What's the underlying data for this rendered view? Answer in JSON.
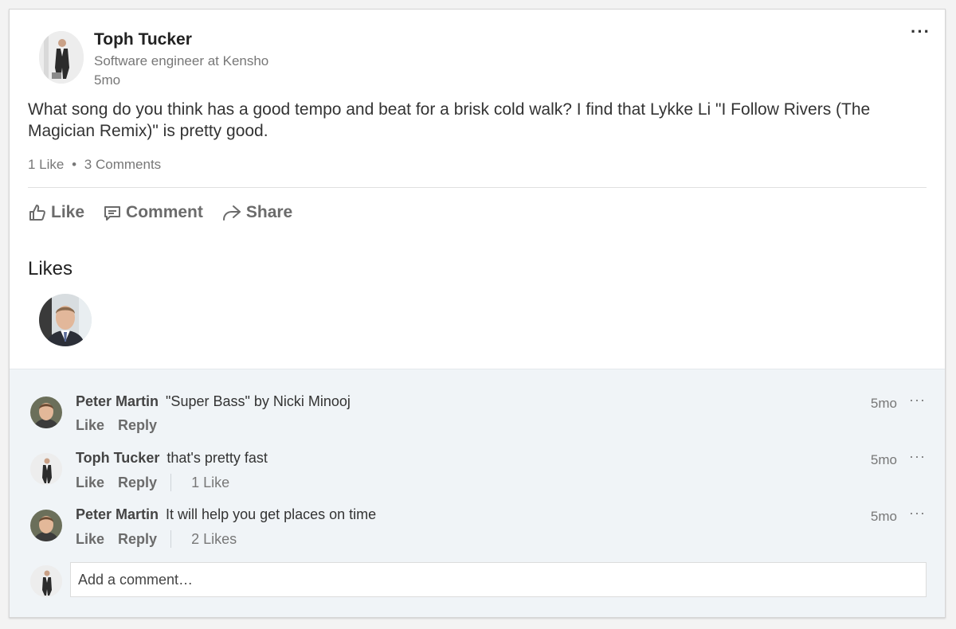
{
  "post": {
    "author_name": "Toph Tucker",
    "author_headline": "Software engineer at Kensho",
    "time": "5mo",
    "more_label": "···",
    "text": "What song do you think has a good tempo and beat for a brisk cold walk? I find that Lykke Li \"I Follow Rivers (The Magician Remix)\" is pretty good.",
    "likes_count": "1 Like",
    "separator": "•",
    "comments_count": "3 Comments",
    "actions": {
      "like": "Like",
      "comment": "Comment",
      "share": "Share"
    }
  },
  "likes_section": {
    "title": "Likes"
  },
  "comments": [
    {
      "author": "Peter Martin",
      "text": "\"Super Bass\" by Nicki Minooj",
      "time": "5mo",
      "like_label": "Like",
      "reply_label": "Reply",
      "likes": "",
      "more_label": "···"
    },
    {
      "author": "Toph Tucker",
      "text": "that's pretty fast",
      "time": "5mo",
      "like_label": "Like",
      "reply_label": "Reply",
      "likes": "1 Like",
      "more_label": "···"
    },
    {
      "author": "Peter Martin",
      "text": "It will help you get places on time",
      "time": "5mo",
      "like_label": "Like",
      "reply_label": "Reply",
      "likes": "2 Likes",
      "more_label": "···"
    }
  ],
  "add_comment": {
    "placeholder": "Add a comment…"
  },
  "colors": {
    "comments_background": "#f0f4f7",
    "action_gray": "#6b6b6b",
    "meta_gray": "#777777"
  },
  "icons": {
    "like": "thumbs-up-icon",
    "comment": "comment-bubble-icon",
    "share": "share-arrow-icon"
  }
}
